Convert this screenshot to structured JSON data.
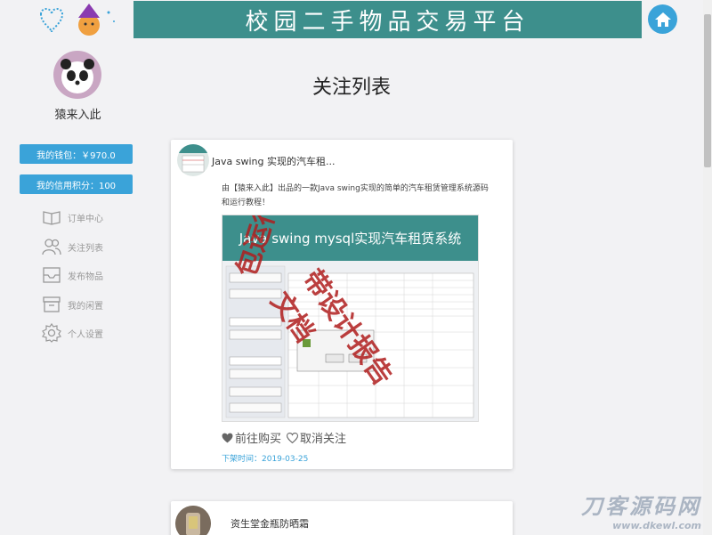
{
  "header": {
    "banner_title": "校园二手物品交易平台",
    "home_icon": "home-icon"
  },
  "sidebar": {
    "username": "猿来入此",
    "wallet_label": "我的钱包：￥970.0",
    "credit_label": "我的信用积分：100",
    "items": [
      {
        "label": "订单中心",
        "icon": "book-icon"
      },
      {
        "label": "关注列表",
        "icon": "users-icon"
      },
      {
        "label": "发布物品",
        "icon": "inbox-icon"
      },
      {
        "label": "我的闲置",
        "icon": "archive-icon"
      },
      {
        "label": "个人设置",
        "icon": "gear-icon"
      }
    ]
  },
  "main": {
    "title": "关注列表",
    "cards": [
      {
        "title": "Java swing 实现的汽车租...",
        "description": "由【猿来入此】出品的一款Java swing实现的简单的汽车租赁管理系统源码和运行教程！",
        "image_heading": "Java swing mysql实现汽车租赁系统",
        "image_watermark_1": "包运行",
        "image_watermark_2": "带设计报告文档",
        "buy_label": "前往购买",
        "unfollow_label": "取消关注",
        "time_label": "下架时间：2019-03-25"
      },
      {
        "title": "资生堂金瓶防晒霜"
      }
    ]
  },
  "site_watermark": {
    "brand": "刀客源码网",
    "url": "www.dkewl.com"
  },
  "colors": {
    "accent": "#3aa3d9",
    "banner": "#3d8f8c",
    "watermark": "#b01e1e"
  }
}
